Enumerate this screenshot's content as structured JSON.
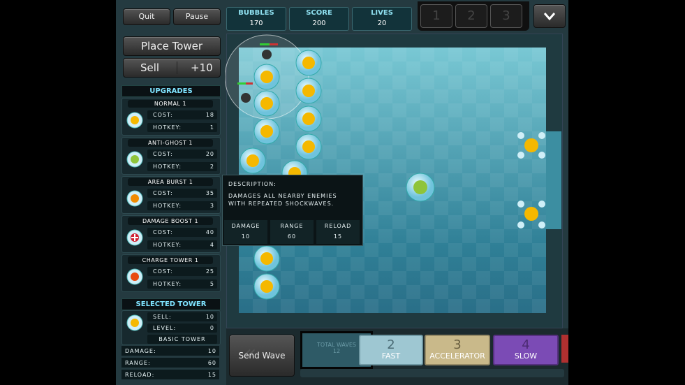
{
  "controls": {
    "quit_label": "Quit",
    "pause_label": "Pause",
    "place_tower_label": "Place Tower",
    "sell_label": "Sell",
    "sell_value": "+10",
    "menu_icon": "chevron-down-icon"
  },
  "stats": [
    {
      "label": "BUBBLES",
      "value": "170"
    },
    {
      "label": "SCORE",
      "value": "200"
    },
    {
      "label": "LIVES",
      "value": "20"
    }
  ],
  "speed_buttons": [
    "1",
    "2",
    "3"
  ],
  "upgrades": {
    "title": "UPGRADES",
    "items": [
      {
        "name": "NORMAL 1",
        "cost_label": "COST:",
        "cost": "18",
        "hotkey_label": "HOTKEY:",
        "hotkey": "1",
        "color": "#f5b800"
      },
      {
        "name": "ANTI-GHOST 1",
        "cost_label": "COST:",
        "cost": "20",
        "hotkey_label": "HOTKEY:",
        "hotkey": "2",
        "color": "#8fc43a"
      },
      {
        "name": "AREA BURST 1",
        "cost_label": "COST:",
        "cost": "35",
        "hotkey_label": "HOTKEY:",
        "hotkey": "3",
        "color": "#f08a00"
      },
      {
        "name": "DAMAGE BOOST 1",
        "cost_label": "COST:",
        "cost": "40",
        "hotkey_label": "HOTKEY:",
        "hotkey": "4",
        "color": "#d02030"
      },
      {
        "name": "CHARGE TOWER 1",
        "cost_label": "COST:",
        "cost": "25",
        "hotkey_label": "HOTKEY:",
        "hotkey": "5",
        "color": "#e84a10"
      }
    ]
  },
  "selected_tower": {
    "title": "SELECTED TOWER",
    "sell_label": "SELL:",
    "sell": "10",
    "level_label": "LEVEL:",
    "level": "0",
    "type": "BASIC TOWER",
    "damage_label": "DAMAGE:",
    "damage": "10",
    "range_label": "RANGE:",
    "range": "60",
    "reload_label": "RELOAD:",
    "reload": "15"
  },
  "description": {
    "title": "DESCRIPTION:",
    "text": "DAMAGES ALL NEARBY ENEMIES WITH REPEATED SHOCKWAVES.",
    "damage_label": "DAMAGE",
    "damage": "10",
    "range_label": "RANGE",
    "range": "60",
    "reload_label": "RELOAD",
    "reload": "15"
  },
  "waves": {
    "send_label": "Send Wave",
    "total_label": "TOTAL WAVES",
    "total_value": "12",
    "items": [
      {
        "number": "2",
        "name": "FAST",
        "color": "#9ec7d2"
      },
      {
        "number": "3",
        "name": "ACCELERATOR",
        "color": "#c9b98a"
      },
      {
        "number": "4",
        "name": "SLOW",
        "color": "#7b4bb5"
      }
    ]
  }
}
